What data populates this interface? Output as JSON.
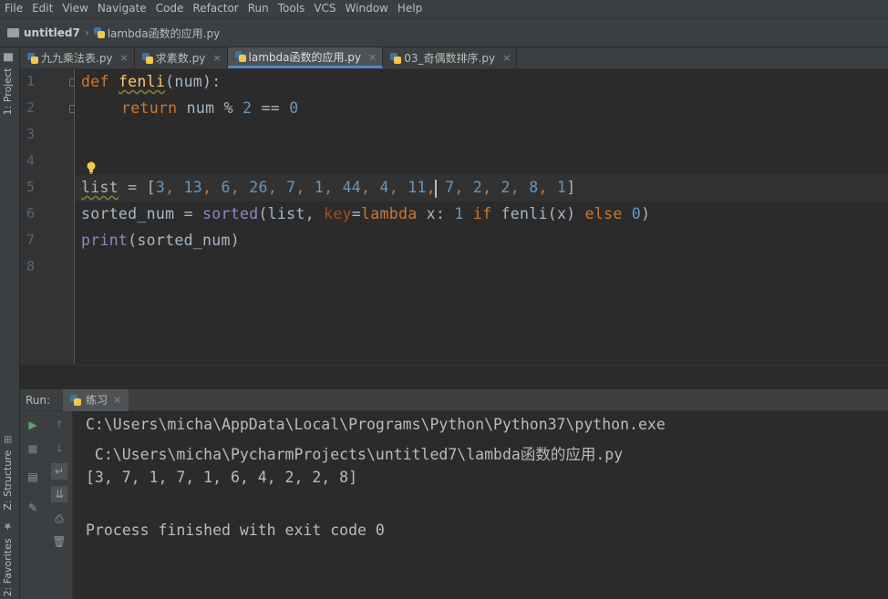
{
  "menu": [
    "File",
    "Edit",
    "View",
    "Navigate",
    "Code",
    "Refactor",
    "Run",
    "Tools",
    "VCS",
    "Window",
    "Help"
  ],
  "breadcrumb": {
    "project": "untitled7",
    "file": "lambda函数的应用.py"
  },
  "left_strip": {
    "project_tab": "1: Project",
    "structure_tab": "Z: Structure",
    "favorites_tab": "2: Favorites"
  },
  "tabs": [
    {
      "label": "九九乘法表.py",
      "active": false
    },
    {
      "label": "求素数.py",
      "active": false
    },
    {
      "label": "lambda函数的应用.py",
      "active": true
    },
    {
      "label": "03_奇偶数排序.py",
      "active": false
    }
  ],
  "line_numbers": [
    "1",
    "2",
    "3",
    "4",
    "5",
    "6",
    "7",
    "8"
  ],
  "code": {
    "l1": {
      "kw": "def",
      "fn": "fenli",
      "rest": "(num):"
    },
    "l2": {
      "kw": "return",
      "a": " num % ",
      "n1": "2",
      "b": " == ",
      "n2": "0"
    },
    "l5": {
      "var": "list",
      "eq": " = [",
      "nums_before": [
        "3",
        "13",
        "6",
        "26",
        "7",
        "1",
        "44",
        "4",
        "11"
      ],
      "nums_after": [
        "7",
        "2",
        "2",
        "8",
        "1"
      ],
      "end": "]"
    },
    "l6": {
      "a": "sorted_num = ",
      "bi1": "sorted",
      "b": "(list, ",
      "pm": "key",
      "c": "=",
      "kw1": "lambda",
      "d": " x: ",
      "n": "1",
      "e": " ",
      "kw2": "if",
      "f": " fenli(x) ",
      "kw3": "else",
      "g": " ",
      "n0": "0",
      "h": ")"
    },
    "l7": {
      "bi": "print",
      "rest": "(sorted_num)"
    }
  },
  "run": {
    "label": "Run:",
    "config": "练习",
    "output": [
      "C:\\Users\\micha\\AppData\\Local\\Programs\\Python\\Python37\\python.exe",
      " C:\\Users\\micha\\PycharmProjects\\untitled7\\lambda函数的应用.py",
      "[3, 7, 1, 7, 1, 6, 4, 2, 2, 8]",
      "",
      "Process finished with exit code 0"
    ]
  }
}
